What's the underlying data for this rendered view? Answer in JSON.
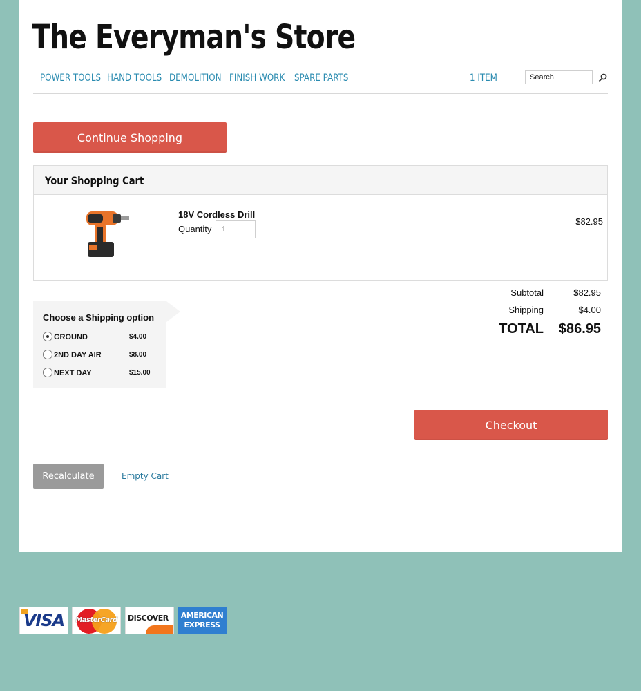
{
  "header": {
    "store_title": "The Everyman's Store"
  },
  "nav": {
    "items": [
      "Power Tools",
      "Hand Tools",
      "Demolition",
      "Finish Work",
      "Spare Parts"
    ],
    "cart_count": "1 Item",
    "search_placeholder": "Search"
  },
  "actions": {
    "continue_label": "Continue Shopping",
    "checkout_label": "Checkout",
    "recalculate_label": "Recalculate",
    "empty_cart_label": "Empty Cart"
  },
  "cart": {
    "heading": "Your Shopping Cart",
    "items": [
      {
        "name": "18V Cordless Drill",
        "quantity_label": "Quantity",
        "quantity": "1",
        "price": "$82.95",
        "image_icon": "cordless-drill-image"
      }
    ]
  },
  "totals": {
    "subtotal_label": "Subtotal",
    "subtotal": "$82.95",
    "shipping_label": "Shipping",
    "shipping": "$4.00",
    "total_label": "TOTAL",
    "total": "$86.95"
  },
  "shipping": {
    "title": "Choose a Shipping option",
    "selected": "GROUND",
    "options": [
      {
        "name": "GROUND",
        "price": "$4.00"
      },
      {
        "name": "2ND DAY AIR",
        "price": "$8.00"
      },
      {
        "name": "NEXT DAY",
        "price": "$15.00"
      }
    ]
  },
  "payment_cards": {
    "visa": "VISA",
    "mastercard": "MasterCard",
    "discover": "DISCOVER",
    "amex_line1": "AMERICAN",
    "amex_line2": "EXPRESS"
  },
  "colors": {
    "background": "#8fc1b8",
    "accent_button": "#d9574a",
    "nav_link": "#2a8bb0",
    "secondary_button": "#9a9a9a"
  }
}
